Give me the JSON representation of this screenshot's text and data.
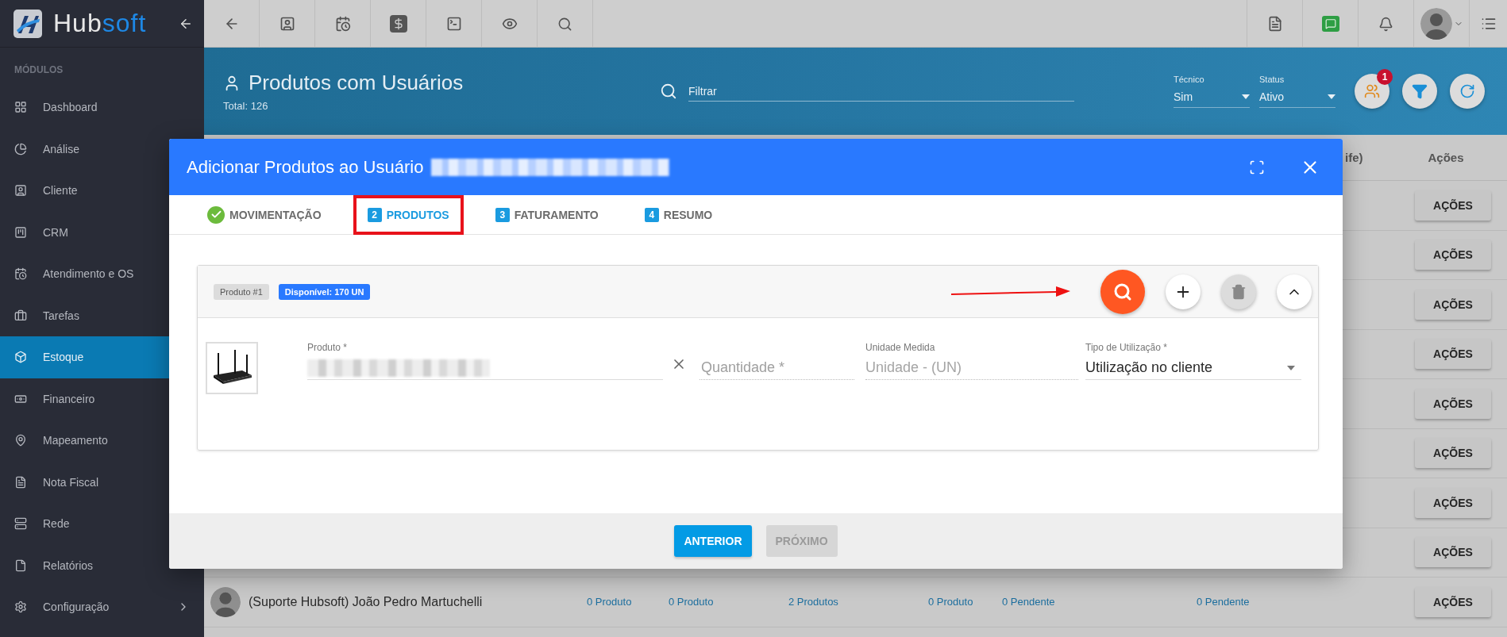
{
  "logo": {
    "text_start": "Hub",
    "text_end": "soft"
  },
  "sidebar": {
    "heading": "MÓDULOS",
    "items": [
      {
        "label": "Dashboard",
        "selected": false,
        "has_submenu": false
      },
      {
        "label": "Análise",
        "selected": false,
        "has_submenu": false
      },
      {
        "label": "Cliente",
        "selected": false,
        "has_submenu": false
      },
      {
        "label": "CRM",
        "selected": false,
        "has_submenu": false
      },
      {
        "label": "Atendimento e OS",
        "selected": false,
        "has_submenu": false
      },
      {
        "label": "Tarefas",
        "selected": false,
        "has_submenu": false
      },
      {
        "label": "Estoque",
        "selected": true,
        "has_submenu": false
      },
      {
        "label": "Financeiro",
        "selected": false,
        "has_submenu": false
      },
      {
        "label": "Mapeamento",
        "selected": false,
        "has_submenu": false
      },
      {
        "label": "Nota Fiscal",
        "selected": false,
        "has_submenu": false
      },
      {
        "label": "Rede",
        "selected": false,
        "has_submenu": false
      },
      {
        "label": "Relatórios",
        "selected": false,
        "has_submenu": false
      },
      {
        "label": "Configuração",
        "selected": false,
        "has_submenu": true
      }
    ]
  },
  "page_header": {
    "title": "Produtos com Usuários",
    "total": "Total: 126",
    "filter_placeholder": "Filtrar",
    "selects": [
      {
        "label": "Técnico",
        "value": "Sim"
      },
      {
        "label": "Status",
        "value": "Ativo"
      }
    ],
    "notification_count": "1"
  },
  "table": {
    "columns": [
      "ife)",
      "Ações"
    ],
    "rows": [
      {
        "action": "AÇÕES"
      },
      {
        "action": "AÇÕES"
      },
      {
        "action": "AÇÕES"
      },
      {
        "action": "AÇÕES"
      },
      {
        "action": "AÇÕES"
      },
      {
        "action": "AÇÕES"
      },
      {
        "action": "AÇÕES"
      },
      {
        "action": "AÇÕES"
      },
      {
        "name": "(Suporte Hubsoft) João Pedro Martuchelli",
        "cells": [
          "0 Produto",
          "0 Produto",
          "2 Produtos",
          "0 Produto",
          "0 Pendente",
          "0 Pendente"
        ],
        "action": "AÇÕES"
      }
    ]
  },
  "modal": {
    "title": "Adicionar Produtos ao Usuário",
    "steps": [
      {
        "label": "MOVIMENTAÇÃO",
        "done": true,
        "selected": false,
        "highlighted": false
      },
      {
        "number": "2",
        "label": "PRODUTOS",
        "done": false,
        "selected": true,
        "highlighted": true
      },
      {
        "number": "3",
        "label": "FATURAMENTO",
        "done": false,
        "selected": false,
        "highlighted": false
      },
      {
        "number": "4",
        "label": "RESUMO",
        "done": false,
        "selected": false,
        "highlighted": false
      }
    ],
    "product_card": {
      "tag": "Produto #1",
      "available": "Disponível: 170 UN",
      "arrow_to_search": true,
      "fields": [
        {
          "kind": "product",
          "label": "Produto *"
        },
        {
          "kind": "quantity",
          "placeholder": "Quantidade *"
        },
        {
          "kind": "unit",
          "label": "Unidade Medida",
          "value": "Unidade - (UN)"
        },
        {
          "kind": "select",
          "label": "Tipo de Utilização *",
          "value": "Utilização no cliente"
        }
      ]
    },
    "buttons": [
      {
        "label": "ANTERIOR",
        "disabled": false
      },
      {
        "label": "PRÓXIMO",
        "disabled": true
      }
    ]
  }
}
